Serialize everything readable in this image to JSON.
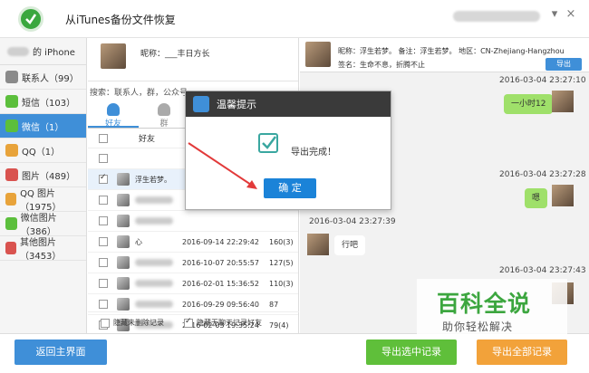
{
  "app": {
    "title": "从iTunes备份文件恢复",
    "close": "×"
  },
  "sidebar": {
    "device_suffix": "的 iPhone",
    "items": [
      {
        "label": "联系人（99）",
        "icon": "contacts-icon",
        "color": "#8a8a8a"
      },
      {
        "label": "短信（103）",
        "icon": "sms-icon",
        "color": "#5cbf3c"
      },
      {
        "label": "微信（1）",
        "icon": "wechat-icon",
        "color": "#5cbf3c",
        "active": true
      },
      {
        "label": "QQ（1）",
        "icon": "qq-icon",
        "color": "#e8a33a"
      },
      {
        "label": "图片（489）",
        "icon": "photos-icon",
        "color": "#d9534f"
      },
      {
        "label": "QQ 图片（1975）",
        "icon": "qq-photos-icon",
        "color": "#e8a33a"
      },
      {
        "label": "微信图片（386）",
        "icon": "wechat-photos-icon",
        "color": "#5cbf3c"
      },
      {
        "label": "其他图片（3453）",
        "icon": "other-photos-icon",
        "color": "#d9534f"
      }
    ]
  },
  "middle": {
    "profile_name": "昵称：___丰日方长",
    "search_placeholder": "搜索：联系人，群，公众号",
    "tabs": [
      "好友",
      "群"
    ],
    "header": "好友",
    "rows": [
      {
        "name": "",
        "date": "",
        "count": ""
      },
      {
        "name": "浮生若梦。",
        "date": "",
        "count": "",
        "checked": true
      },
      {
        "name": "",
        "date": "",
        "count": ""
      },
      {
        "name": "",
        "date": "",
        "count": ""
      },
      {
        "name": "心",
        "date": "2016-09-14 22:29:42",
        "count": "160(3)"
      },
      {
        "name": "",
        "date": "2016-10-07 20:55:57",
        "count": "127(5)"
      },
      {
        "name": "",
        "date": "2016-02-01 15:36:52",
        "count": "110(3)"
      },
      {
        "name": "",
        "date": "2016-09-29 09:56:40",
        "count": "87"
      },
      {
        "name": "",
        "date": "2016-02-03 19:35:24",
        "count": "79(4)"
      }
    ],
    "opt_hide_deleted": "隐藏未删除记录",
    "opt_hide_no_chat": "隐藏无聊天记录好友"
  },
  "right": {
    "header_line1": "昵称：浮生若梦。    备注：浮生若梦。    地区：CN-Zhejiang-Hangzhou",
    "header_line2": "签名：生命不息，折腾不止",
    "export_label": "导出",
    "messages": [
      {
        "time": "2016-03-04 23:27:10",
        "text": "一小时12",
        "from": "me"
      },
      {
        "time": "2016-03-04 23:27:28",
        "text": "嗯",
        "from": "me"
      },
      {
        "time": "2016-03-04 23:27:39",
        "text": "行吧",
        "from": "other"
      },
      {
        "time": "2016-03-04 23:27:43",
        "text": "",
        "from": "me"
      }
    ]
  },
  "bottom": {
    "back_label": "返回主界面",
    "export_selected": "导出选中记录",
    "export_all": "导出全部记录"
  },
  "dialog": {
    "title": "温馨提示",
    "message": "导出完成！",
    "ok_label": "确 定"
  },
  "watermark": {
    "main": "百科全说",
    "sub": "助你轻松解决"
  }
}
